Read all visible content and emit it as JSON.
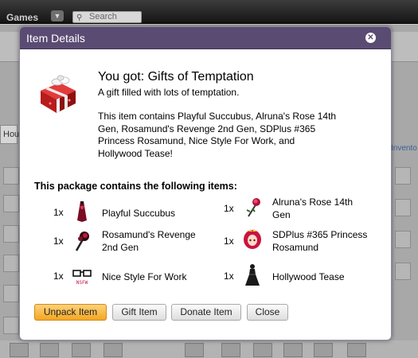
{
  "background": {
    "topbar": {
      "games_label": "Games",
      "search_placeholder": "Search"
    },
    "tab_partial_label": "Hou",
    "inventory_partial_label": "Invento"
  },
  "dialog": {
    "header_title": "Item Details",
    "close_icon": "close-icon",
    "title": "You got: Gifts of Temptation",
    "subtitle": "A gift filled with lots of temptation.",
    "description": "This item contains Playful Succubus, Alruna's Rose 14th Gen, Rosamund's Revenge 2nd Gen, SDPlus #365 Princess Rosamund, Nice Style For Work, and Hollywood Tease!",
    "package_heading": "This package contains the following items:",
    "items": [
      {
        "qty": "1x",
        "name": "Playful Succubus",
        "icon": "succubus-outfit-icon"
      },
      {
        "qty": "1x",
        "name": "Alruna's Rose 14th Gen",
        "icon": "rose-icon"
      },
      {
        "qty": "1x",
        "name": "Rosamund's Revenge 2nd Gen",
        "icon": "rose-bouquet-icon"
      },
      {
        "qty": "1x",
        "name": "SDPlus #365 Princess Rosamund",
        "icon": "princess-avatar-icon"
      },
      {
        "qty": "1x",
        "name": "Nice Style For Work",
        "icon": "glasses-icon"
      },
      {
        "qty": "1x",
        "name": "Hollywood Tease",
        "icon": "black-dress-icon"
      }
    ],
    "buttons": {
      "unpack": "Unpack Item",
      "gift": "Gift Item",
      "donate": "Donate Item",
      "close": "Close"
    }
  },
  "colors": {
    "header_bg": "#5a4b73",
    "primary_button": "#f3a623"
  }
}
